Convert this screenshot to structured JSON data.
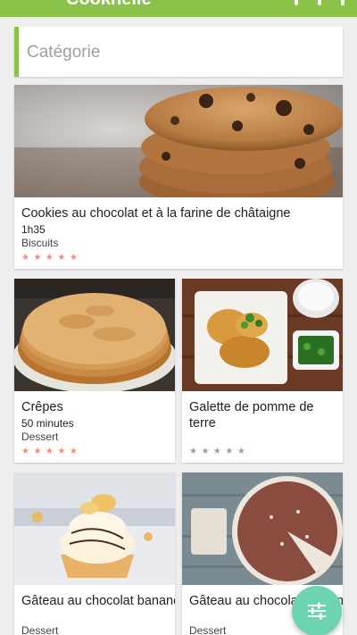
{
  "app": {
    "title": "Cookhelle",
    "accent_color": "#8bc34a",
    "fab_color": "#6cd4b3",
    "fab_icon": "filter-sliders-icon",
    "star_color": "#f28b78"
  },
  "filter": {
    "placeholder": "Catégorie"
  },
  "recipes": [
    {
      "title": "Cookies au chocolat et à la farine de châtaigne",
      "time": "1h35",
      "category": "Biscuits",
      "stars": "★★★★★",
      "image": "cookies-photo"
    },
    {
      "title": "Crêpes",
      "time": "50 minutes",
      "category": "Dessert",
      "stars": "★★★★★",
      "image": "crepes-photo"
    },
    {
      "title": "Galette de pomme de terre",
      "time": "",
      "category": "",
      "stars": "★★★★★",
      "image": "galette-photo"
    },
    {
      "title": "Gâteau au chocolat banane avec glaçage à la",
      "time": "",
      "category": "Dessert",
      "stars": "",
      "image": "cupcake-photo"
    },
    {
      "title": "Gâteau au chocolat aux amandes sans",
      "time": "",
      "category": "Dessert",
      "stars": "",
      "image": "chocolate-cake-photo"
    }
  ]
}
